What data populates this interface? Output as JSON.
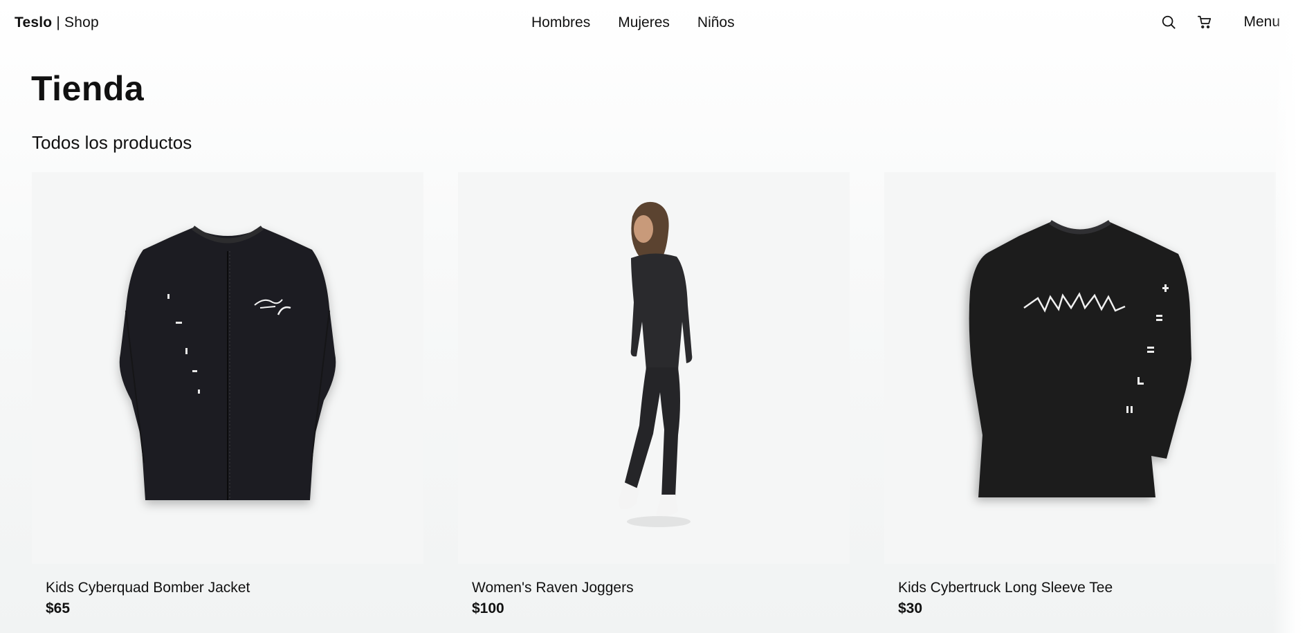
{
  "header": {
    "logo_brand": "Teslo",
    "logo_sep": " | ",
    "logo_shop": "Shop",
    "nav": [
      "Hombres",
      "Mujeres",
      "Niños"
    ],
    "icons": [
      "search-icon",
      "cart-icon"
    ],
    "menu_label": "Menu"
  },
  "main": {
    "title": "Tienda",
    "subtitle": "Todos los productos",
    "products": [
      {
        "name": "Kids Cyberquad Bomber Jacket",
        "price": "$65",
        "image": "black-bomber-jacket"
      },
      {
        "name": "Women's Raven Joggers",
        "price": "$100",
        "image": "model-black-sweatsuit"
      },
      {
        "name": "Kids Cybertruck Long Sleeve Tee",
        "price": "$30",
        "image": "black-long-sleeve-tee"
      }
    ]
  },
  "colors": {
    "text": "#111111",
    "card_bg": "#f5f6f6",
    "garment": "#1c1c1e"
  }
}
